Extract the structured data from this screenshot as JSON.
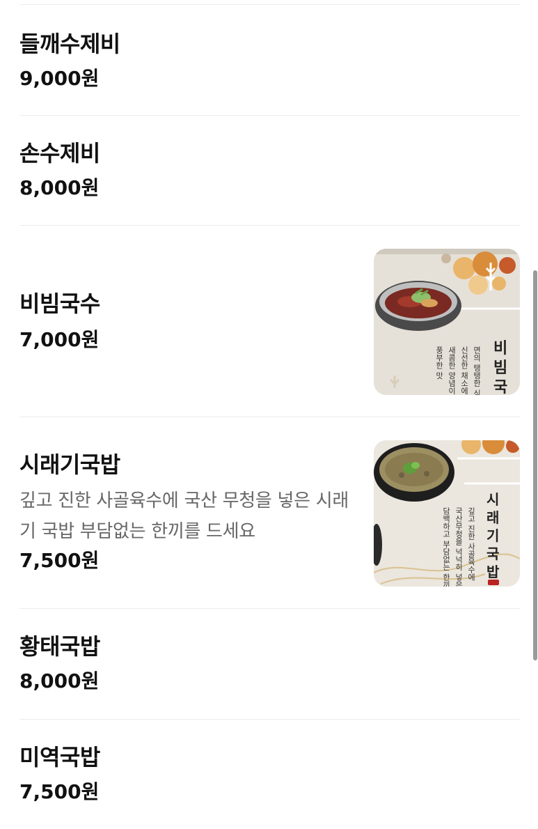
{
  "menu": {
    "items": [
      {
        "name": "들깨수제비",
        "price": "9,000원"
      },
      {
        "name": "손수제비",
        "price": "8,000원"
      },
      {
        "name": "비빔국수",
        "price": "7,000원",
        "photo": {
          "title": "비빔국",
          "lines": [
            "면의 탱탱한 식",
            "신선한 채소에",
            "새콤한 양념이",
            "풍부한 맛"
          ]
        }
      },
      {
        "name": "시래기국밥",
        "description": "깊고 진한 사골육수에 국산 무청을 넣은 시래기 국밥 부담없는 한끼를 드세요",
        "price": "7,500원",
        "photo": {
          "title": "시래기국밥",
          "lines": [
            "깊고 진한 사골육수에",
            "국산무청을 넉넉히 넣은,",
            "담백하고 부담없는 한끼"
          ]
        }
      },
      {
        "name": "황태국밥",
        "price": "8,000원"
      },
      {
        "name": "미역국밥",
        "price": "7,500원"
      }
    ]
  },
  "colors": {
    "text": "#111111",
    "description": "#666666",
    "divider": "#ececec"
  }
}
